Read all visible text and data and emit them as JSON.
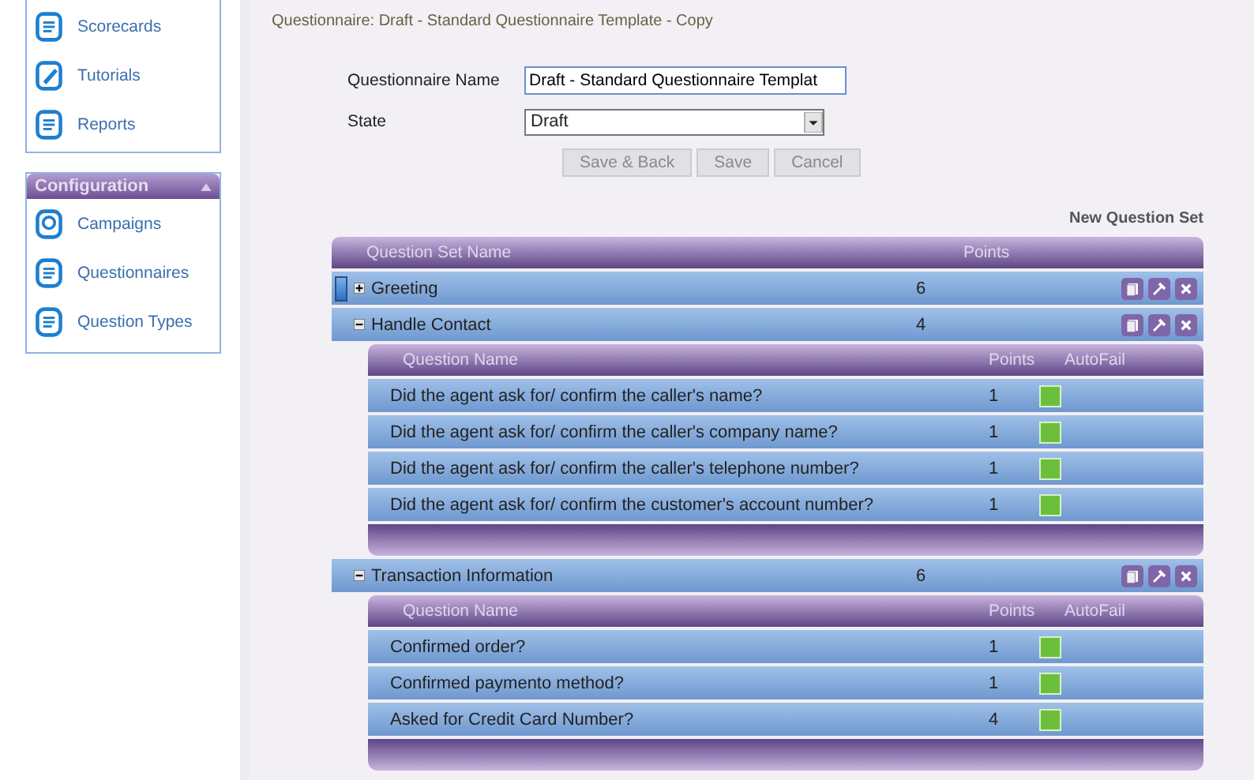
{
  "sidebar": {
    "top_items": [
      {
        "label": "Scorecards"
      },
      {
        "label": "Tutorials"
      },
      {
        "label": "Reports"
      }
    ],
    "configuration": {
      "title": "Configuration",
      "items": [
        {
          "label": "Campaigns"
        },
        {
          "label": "Questionnaires"
        },
        {
          "label": "Question Types"
        }
      ]
    }
  },
  "page_title": "Questionnaire: Draft - Standard Questionnaire Template - Copy",
  "form": {
    "name_label": "Questionnaire Name",
    "name_value": "Draft - Standard Questionnaire Templat",
    "state_label": "State",
    "state_value": "Draft",
    "buttons": [
      {
        "label": "Save & Back",
        "disabled": true
      },
      {
        "label": "Save",
        "disabled": true
      },
      {
        "label": "Cancel",
        "disabled": true
      }
    ]
  },
  "new_set_link": "New Question Set",
  "table": {
    "columns": [
      "Question Set Name",
      "Points"
    ],
    "sets": [
      {
        "name": "Greeting",
        "points": "6",
        "selected": true,
        "expanded": false
      },
      {
        "name": "Handle Contact",
        "points": "4",
        "selected": false,
        "expanded": true,
        "columns": [
          "Question Name",
          "Points",
          "AutoFail"
        ],
        "questions": [
          {
            "text": "Did the agent ask for/ confirm the caller's name?",
            "points": "1",
            "autofail": true
          },
          {
            "text": "Did the agent ask for/ confirm the caller's company name?",
            "points": "1",
            "autofail": true
          },
          {
            "text": "Did the agent ask for/ confirm the caller's telephone number?",
            "points": "1",
            "autofail": true
          },
          {
            "text": "Did the agent ask for/ confirm the customer's account number?",
            "points": "1",
            "autofail": true
          }
        ]
      },
      {
        "name": "Transaction Information",
        "points": "6",
        "selected": false,
        "expanded": true,
        "columns": [
          "Question Name",
          "Points",
          "AutoFail"
        ],
        "questions": [
          {
            "text": "Confirmed order?",
            "points": "1",
            "autofail": true
          },
          {
            "text": "Confirmed paymento method?",
            "points": "1",
            "autofail": true
          },
          {
            "text": "Asked for Credit Card Number?",
            "points": "4",
            "autofail": true
          }
        ]
      }
    ]
  }
}
